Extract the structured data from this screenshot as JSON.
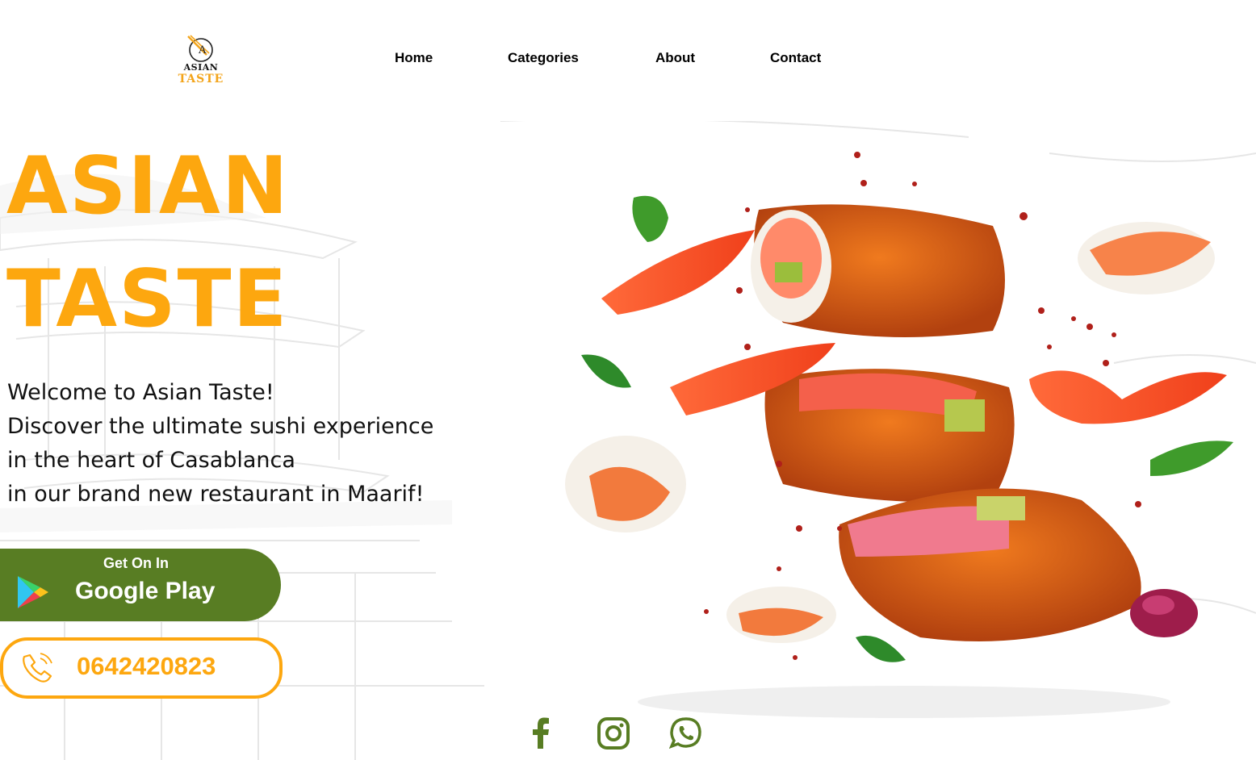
{
  "brand": {
    "logo_word1": "ASIAN",
    "logo_word2": "TASTE",
    "accent": "#fda70f",
    "green": "#587d23"
  },
  "nav": {
    "items": [
      "Home",
      "Categories",
      "About",
      "Contact"
    ]
  },
  "hero": {
    "title_line1": "ASIAN",
    "title_line2": "TASTE",
    "welcome_lines": [
      "Welcome to Asian Taste!",
      "Discover the ultimate sushi experience",
      "in the heart of Casablanca",
      "in our brand new restaurant in Maarif!"
    ]
  },
  "store_button": {
    "small_label": "Get On In",
    "big_label": "Google Play",
    "icon": "google-play-icon"
  },
  "phone": {
    "number": "0642420823",
    "icon": "phone-icon"
  },
  "socials": [
    {
      "name": "facebook",
      "icon": "facebook-icon"
    },
    {
      "name": "instagram",
      "icon": "instagram-icon"
    },
    {
      "name": "whatsapp",
      "icon": "whatsapp-icon"
    }
  ]
}
